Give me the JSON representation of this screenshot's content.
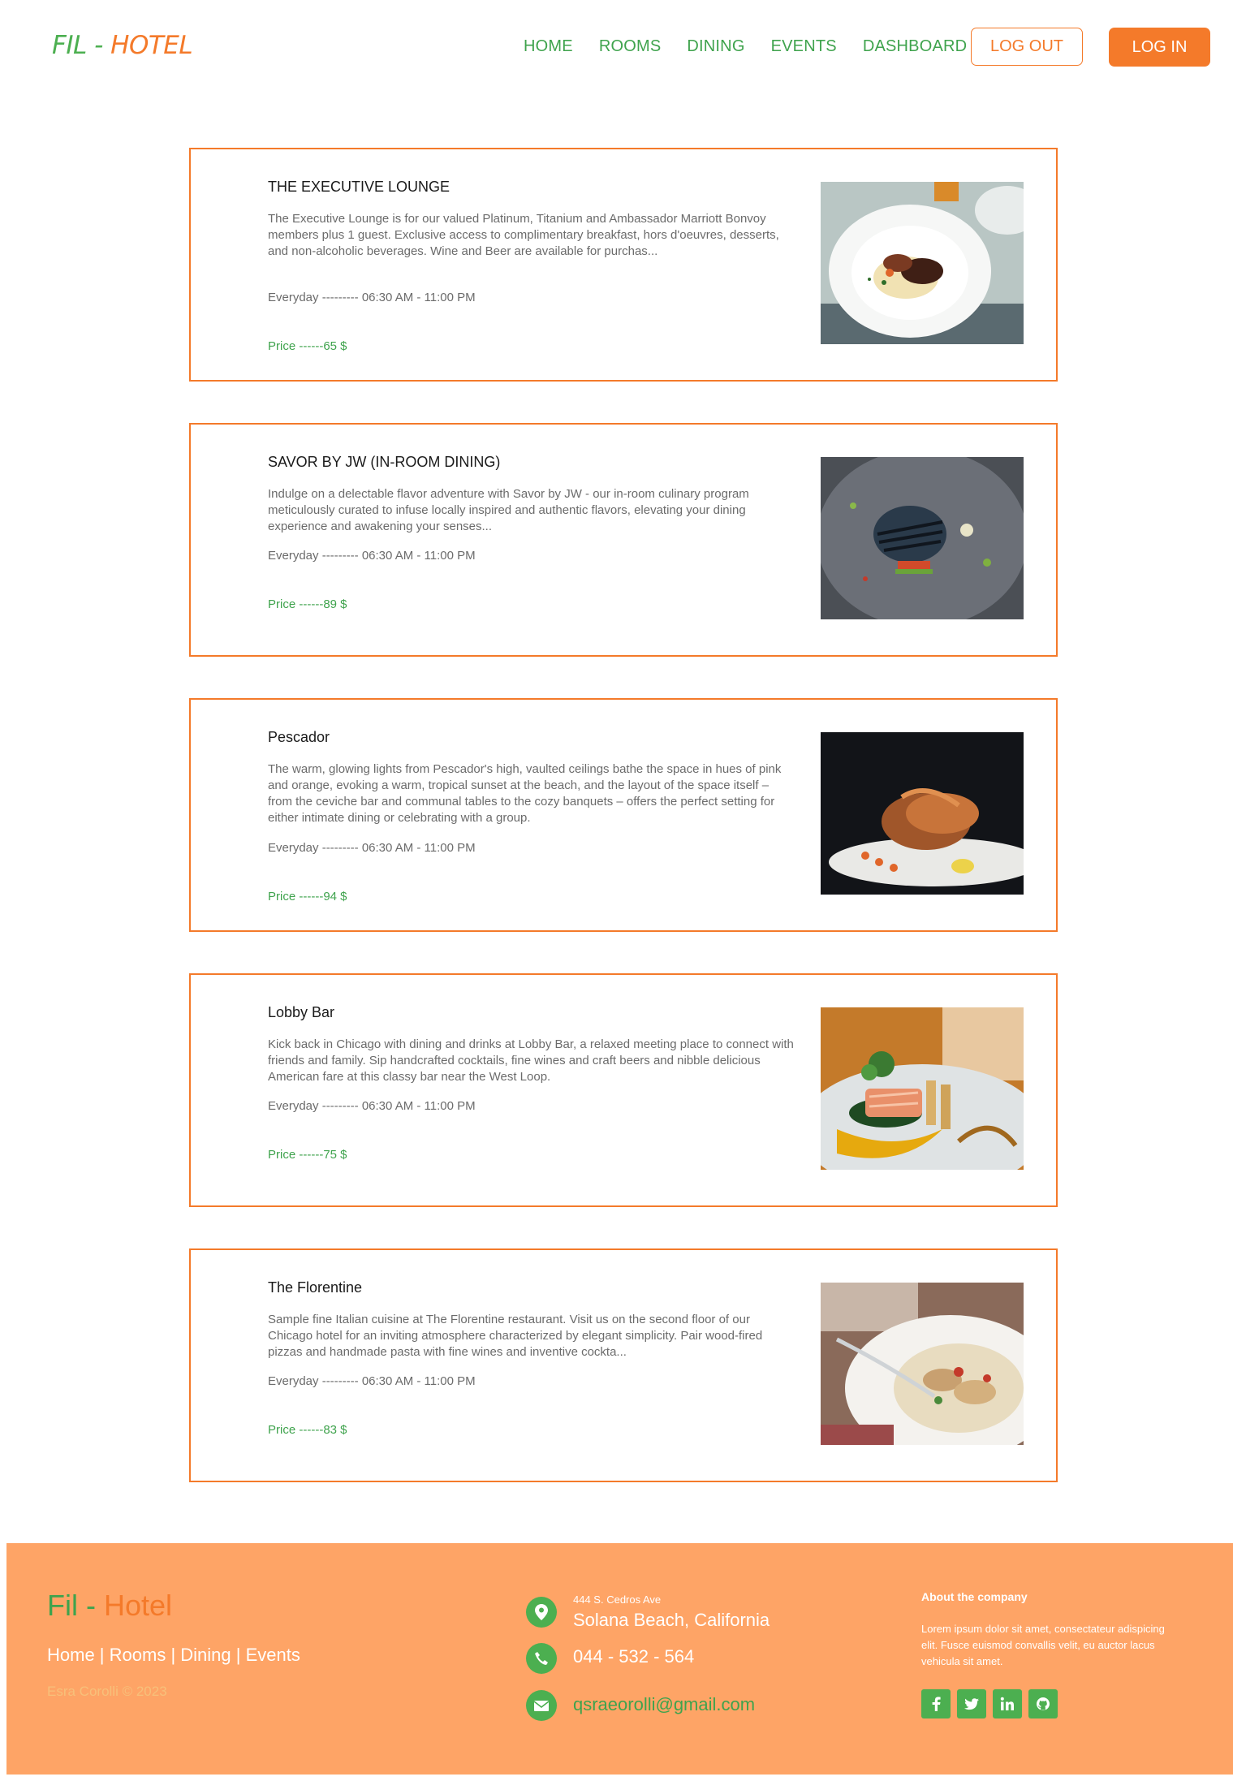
{
  "brand": {
    "part1": "FIL - ",
    "part2": "HOTEL"
  },
  "nav": {
    "home": "HOME",
    "rooms": "ROOMS",
    "dining": "DINING",
    "events": "EVENTS",
    "dashboard": "DASHBOARD",
    "logout": "LOG OUT",
    "login": "LOG IN"
  },
  "restaurants": [
    {
      "title": "THE EXECUTIVE LOUNGE",
      "description": "The Executive Lounge is for our valued Platinum, Titanium and Ambassador Marriott Bonvoy members plus 1 guest. Exclusive access to complimentary breakfast, hors d'oeuvres, desserts, and non-alcoholic beverages. Wine and Beer are available for purchas...",
      "hours": "Everyday --------- 06:30 AM - 11:00 PM",
      "price": "Price ------65 $"
    },
    {
      "title": "SAVOR BY JW (IN-ROOM DINING)",
      "description": "Indulge on a delectable flavor adventure with Savor by JW - our in-room culinary program meticulously curated to infuse locally inspired and authentic flavors, elevating your dining experience and awakening your senses...",
      "hours": "Everyday --------- 06:30 AM - 11:00 PM",
      "price": "Price ------89 $"
    },
    {
      "title": "Pescador",
      "description": "The warm, glowing lights from Pescador's high, vaulted ceilings bathe the space in hues of pink and orange, evoking a warm, tropical sunset at the beach, and the layout of the space itself – from the ceviche bar and communal tables to the cozy banquets – offers the perfect setting for either intimate dining or celebrating with a group.",
      "hours": "Everyday --------- 06:30 AM - 11:00 PM",
      "price": "Price ------94 $"
    },
    {
      "title": "Lobby Bar",
      "description": "Kick back in Chicago with dining and drinks at Lobby Bar, a relaxed meeting place to connect with friends and family. Sip handcrafted cocktails, fine wines and craft beers and nibble delicious American fare at this classy bar near the West Loop.",
      "hours": "Everyday --------- 06:30 AM - 11:00 PM",
      "price": "Price ------75 $"
    },
    {
      "title": "The Florentine",
      "description": "Sample fine Italian cuisine at The Florentine restaurant. Visit us on the second floor of our Chicago hotel for an inviting atmosphere characterized by elegant simplicity. Pair wood-fired pizzas and handmade pasta with fine wines and inventive cockta...",
      "hours": "Everyday --------- 06:30 AM - 11:00 PM",
      "price": "Price ------83 $"
    }
  ],
  "footer": {
    "brand1": "Fil - ",
    "brand2": "Hotel",
    "link_home": "Home",
    "sep": " | ",
    "link_rooms": "Rooms",
    "link_dining": "Dining",
    "link_events": "Events",
    "copyright": "Esra Corolli © 2023",
    "street": "444 S. Cedros Ave",
    "city": "Solana Beach, California",
    "phone": "044 - 532 - 564",
    "email": "qsraeorolli@gmail.com",
    "about_title": "About the company",
    "about_text": "Lorem ipsum dolor sit amet, consectateur adispicing elit. Fusce euismod convallis velit, eu auctor lacus vehicula sit amet.",
    "icons": [
      "map-marker-icon",
      "phone-icon",
      "envelope-icon",
      "facebook-icon",
      "twitter-icon",
      "linkedin-icon",
      "github-icon"
    ]
  },
  "colors": {
    "accent": "#f47a2a",
    "green": "#3fa34d",
    "footer_bg": "#fea466"
  }
}
